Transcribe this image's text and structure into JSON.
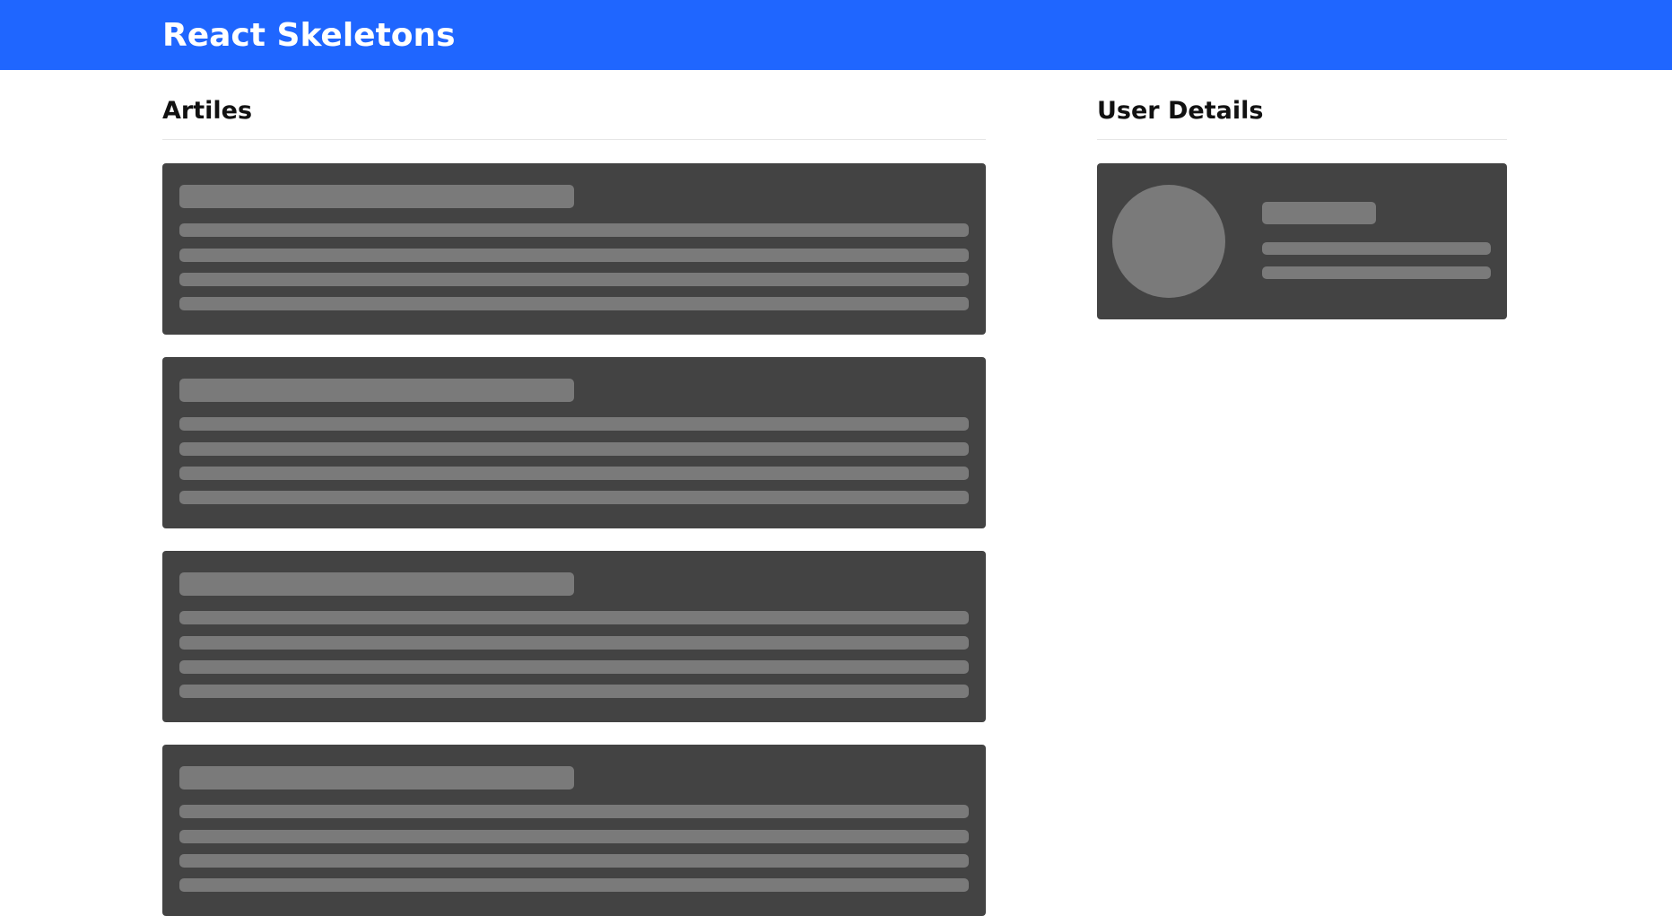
{
  "app": {
    "title": "React Skeletons",
    "brand_color": "#1f66ff"
  },
  "articles_section": {
    "title": "Artiles",
    "placeholder_count": 4
  },
  "user_section": {
    "title": "User Details"
  },
  "skeleton_colors": {
    "card": "#434343",
    "shimmer": "#7a7a7a"
  }
}
